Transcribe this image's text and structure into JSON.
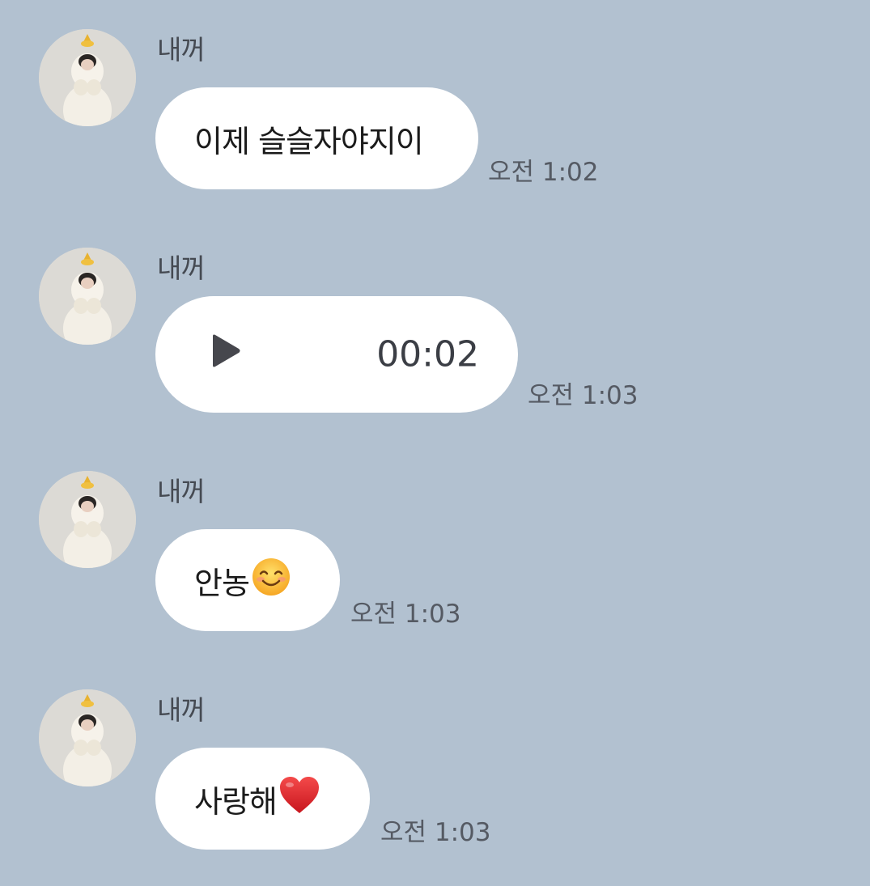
{
  "messages": [
    {
      "sender": "내꺼",
      "type": "text",
      "text": "이제 슬슬자야지이",
      "time": "오전 1:02"
    },
    {
      "sender": "내꺼",
      "type": "voice",
      "duration": "00:02",
      "time": "오전 1:03"
    },
    {
      "sender": "내꺼",
      "type": "text",
      "text": "안농",
      "emoji": "smiling-face-icon",
      "time": "오전 1:03"
    },
    {
      "sender": "내꺼",
      "type": "text",
      "text": "사랑해",
      "emoji": "red-heart-icon",
      "time": "오전 1:03"
    }
  ],
  "colors": {
    "background": "#b2c1d0",
    "bubble": "#ffffff",
    "sender_text": "#454a52",
    "time_text": "#555a63"
  }
}
